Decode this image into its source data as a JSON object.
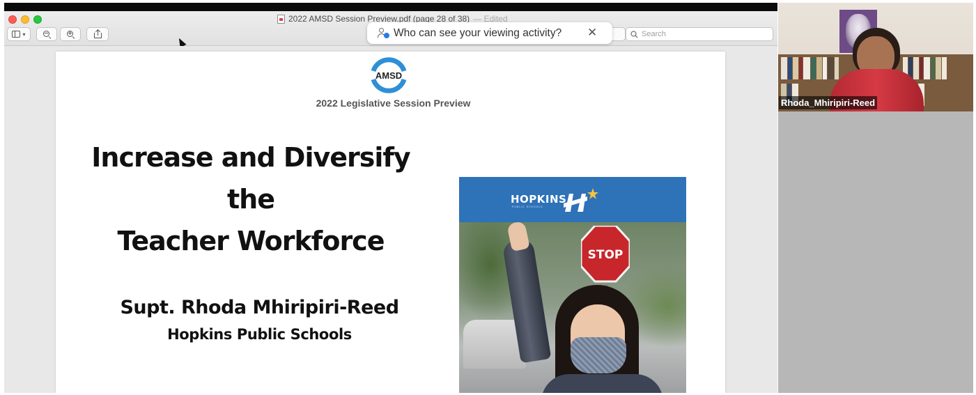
{
  "window": {
    "title": "2022 AMSD Session Preview.pdf (page 28 of 38)",
    "edited": "— Edited"
  },
  "toolbar": {
    "search_placeholder": "Search"
  },
  "notification": {
    "text": "Who can see your viewing activity?",
    "close_glyph": "✕"
  },
  "pdf": {
    "logo_text": "AMSD",
    "tagline": "2022 Legislative Session Preview",
    "title_lines": [
      "Increase and Diversify",
      "the",
      "Teacher Workforce"
    ],
    "presenter": "Supt. Rhoda Mhiripiri-Reed",
    "district": "Hopkins Public Schools",
    "brochure": {
      "wordmark": "HOPKINS",
      "sub": "PUBLIC SCHOOLS",
      "stop_sign": "STOP"
    }
  },
  "video": {
    "participant_name": "Rhoda_Mhiripiri-Reed"
  },
  "colors": {
    "hopkins_blue": "#2e72b8",
    "amsd_blue": "#2f8fd6",
    "close_red": "#fe5f57",
    "minimize_yellow": "#febc2e",
    "maximize_green": "#28c840"
  },
  "icons": {
    "sidebar": "sidebar-icon",
    "zoom_out": "zoom-out-icon",
    "zoom_in": "zoom-in-icon",
    "share": "share-icon",
    "search": "search-icon",
    "privacy": "person-icon",
    "close": "close-icon"
  }
}
